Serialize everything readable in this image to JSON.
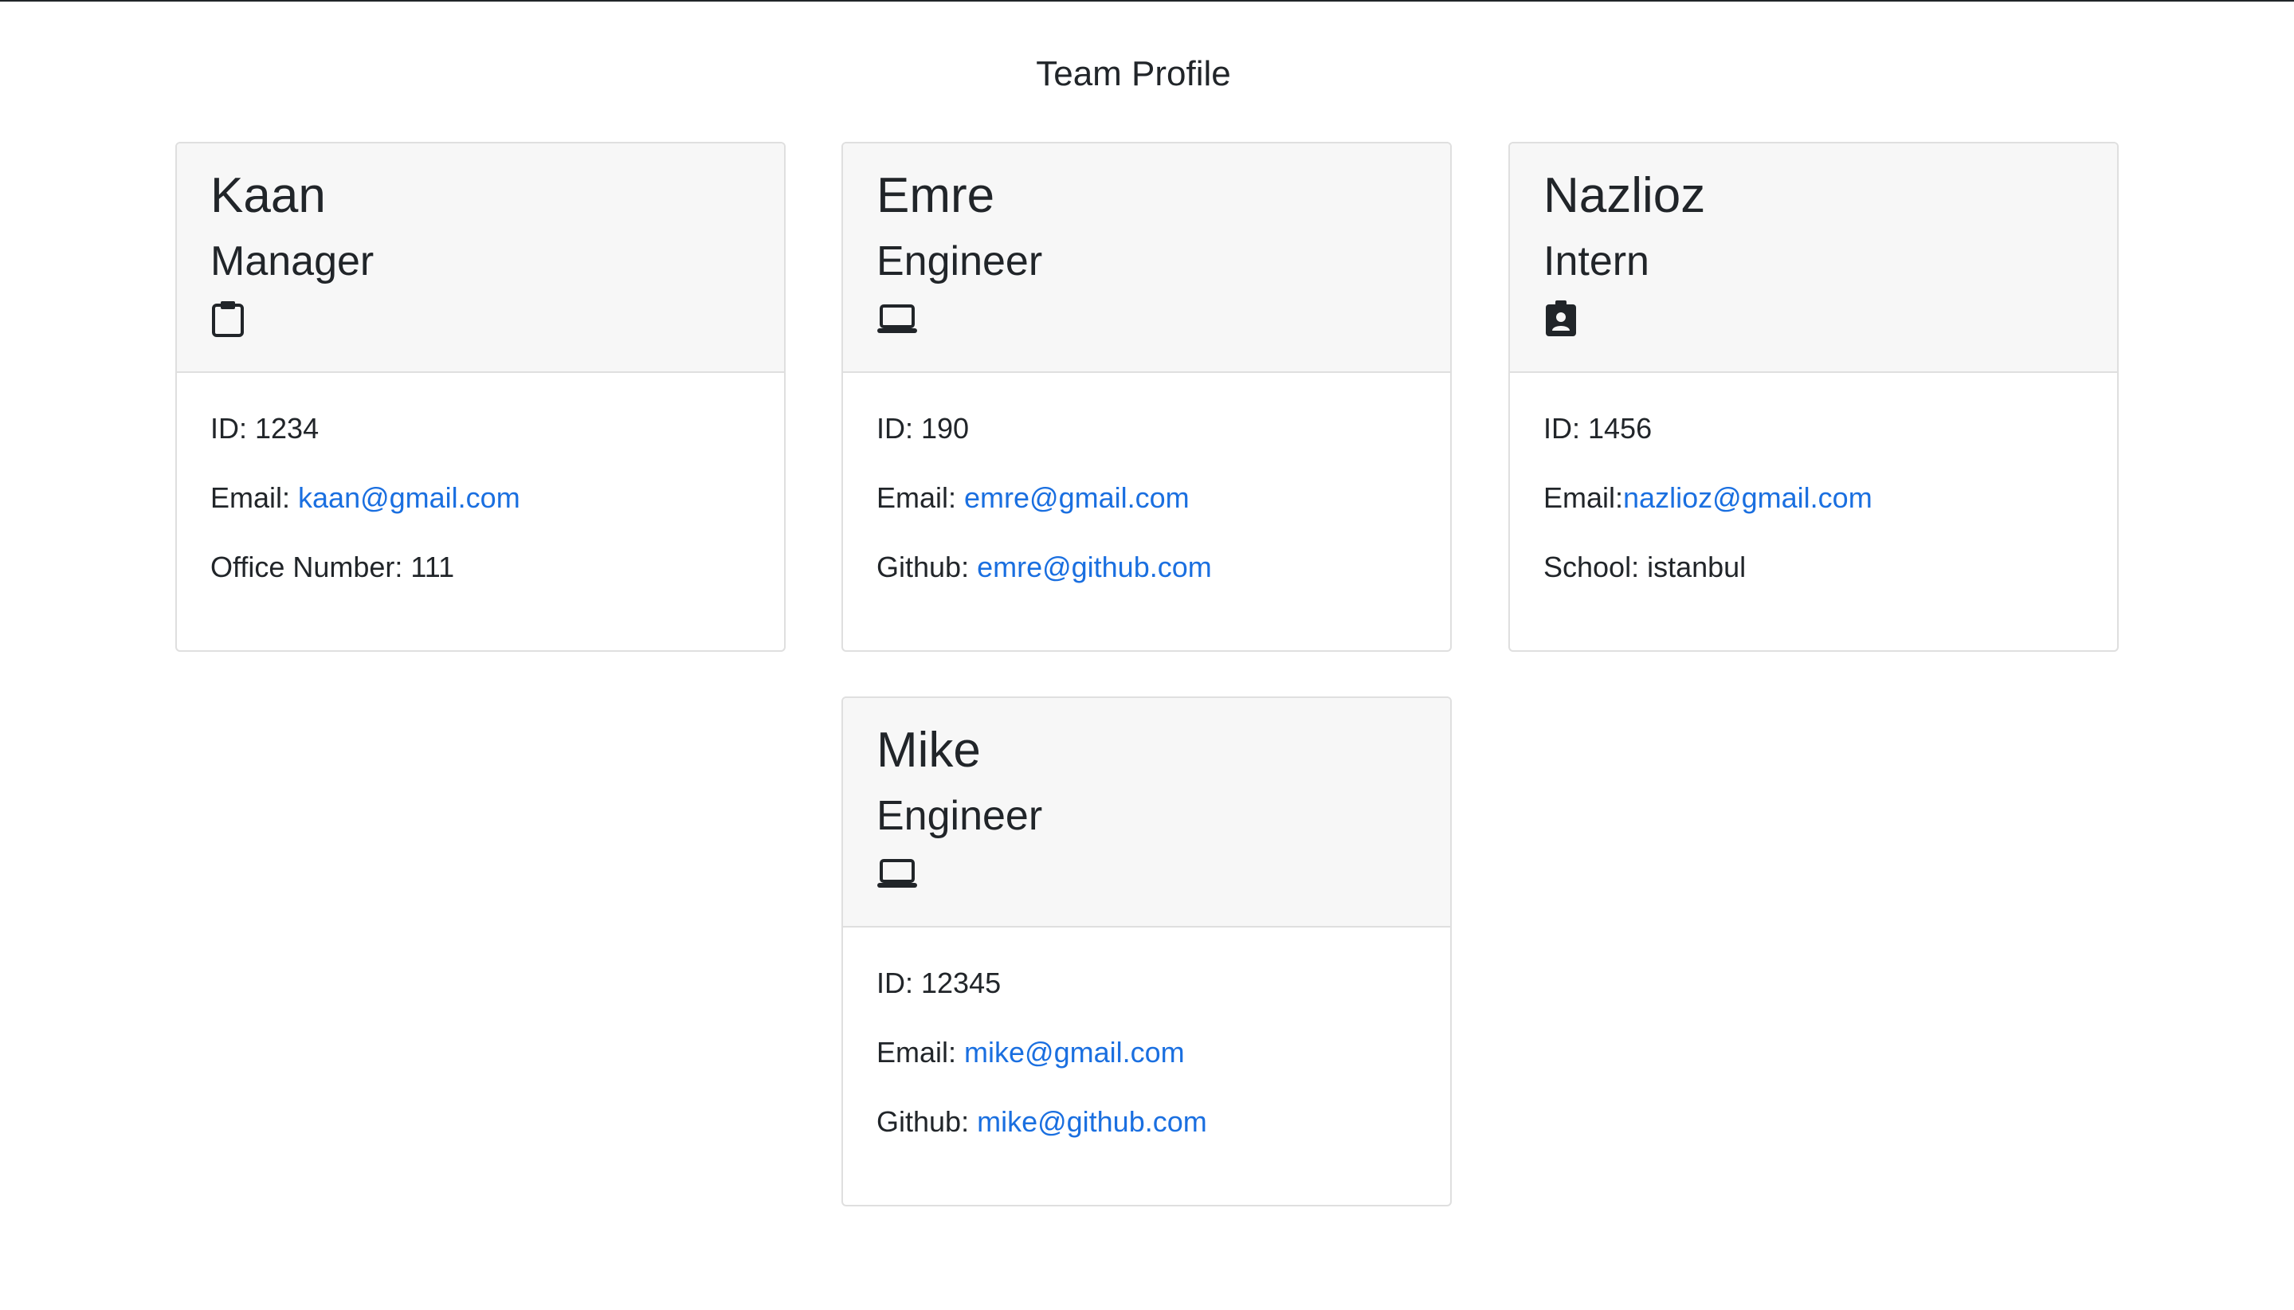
{
  "page_title": "Team Profile",
  "colors": {
    "link": "#1a6fe0",
    "header_bg": "#f7f7f7",
    "border": "#dfdfdf",
    "text": "#212529"
  },
  "members": [
    {
      "name": "Kaan",
      "role": "Manager",
      "icon": "clipboard-icon",
      "id_text": "ID: 1234",
      "email_label": "Email: ",
      "email": "kaan@gmail.com",
      "extra_label": "Office Number: 111",
      "extra_link": ""
    },
    {
      "name": "Emre",
      "role": "Engineer",
      "icon": "laptop-icon",
      "id_text": "ID: 190",
      "email_label": "Email: ",
      "email": "emre@gmail.com",
      "extra_label": "Github: ",
      "extra_link": "emre@github.com"
    },
    {
      "name": "Nazlioz",
      "role": "Intern",
      "icon": "badge-icon",
      "id_text": "ID: 1456",
      "email_label": "Email:",
      "email": "nazlioz@gmail.com",
      "extra_label": "School: istanbul",
      "extra_link": ""
    },
    {
      "name": "Mike",
      "role": "Engineer",
      "icon": "laptop-icon",
      "id_text": "ID: 12345",
      "email_label": "Email: ",
      "email": "mike@gmail.com",
      "extra_label": "Github: ",
      "extra_link": "mike@github.com"
    }
  ]
}
